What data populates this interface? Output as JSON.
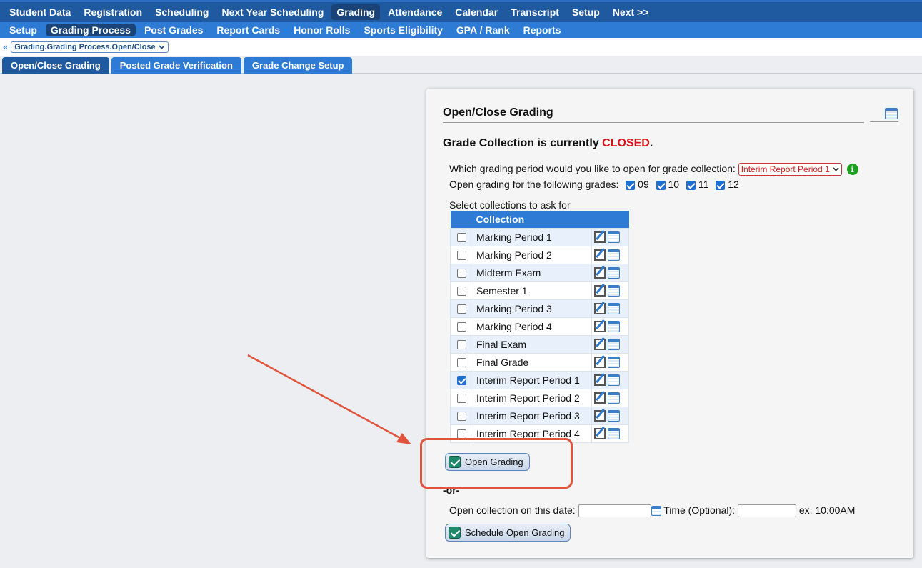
{
  "topnav": [
    "Student Data",
    "Registration",
    "Scheduling",
    "Next Year Scheduling",
    "Grading",
    "Attendance",
    "Calendar",
    "Transcript",
    "Setup",
    "Next >>"
  ],
  "subnav": [
    "Setup",
    "Grading Process",
    "Post Grades",
    "Report Cards",
    "Honor Rolls",
    "Sports Eligibility",
    "GPA / Rank",
    "Reports"
  ],
  "breadcrumb": {
    "back": "«",
    "label": "Grading.Grading Process.Open/Close"
  },
  "tabs": [
    "Open/Close Grading",
    "Posted Grade Verification",
    "Grade Change Setup"
  ],
  "panel": {
    "title": "Open/Close Grading",
    "status_prefix": "Grade Collection is currently ",
    "status_value": "CLOSED",
    "status_suffix": ".",
    "period_question": "Which grading period would you like to open for grade collection:",
    "period_selected": "Interim Report Period 1",
    "grades_label": "Open grading for the following grades:",
    "grades": [
      "09",
      "10",
      "11",
      "12"
    ],
    "collections_label": "Select collections to ask for",
    "collection_header": "Collection",
    "collections": [
      {
        "name": "Marking Period 1",
        "checked": false
      },
      {
        "name": "Marking Period 2",
        "checked": false
      },
      {
        "name": "Midterm Exam",
        "checked": false
      },
      {
        "name": "Semester 1",
        "checked": false
      },
      {
        "name": "Marking Period 3",
        "checked": false
      },
      {
        "name": "Marking Period 4",
        "checked": false
      },
      {
        "name": "Final Exam",
        "checked": false
      },
      {
        "name": "Final Grade",
        "checked": false
      },
      {
        "name": "Interim Report Period 1",
        "checked": true
      },
      {
        "name": "Interim Report Period 2",
        "checked": false
      },
      {
        "name": "Interim Report Period 3",
        "checked": false
      },
      {
        "name": "Interim Report Period 4",
        "checked": false
      }
    ],
    "open_button": "Open Grading",
    "or_text": "-or-",
    "date_label": "Open collection on this date:",
    "time_label": "Time (Optional):",
    "time_example": "ex. 10:00AM",
    "schedule_button": "Schedule Open Grading"
  },
  "colors": {
    "nav": "#1f5aa0",
    "subnav": "#2e7bd6",
    "closed": "#e0101a",
    "annotation": "#e0533c"
  }
}
